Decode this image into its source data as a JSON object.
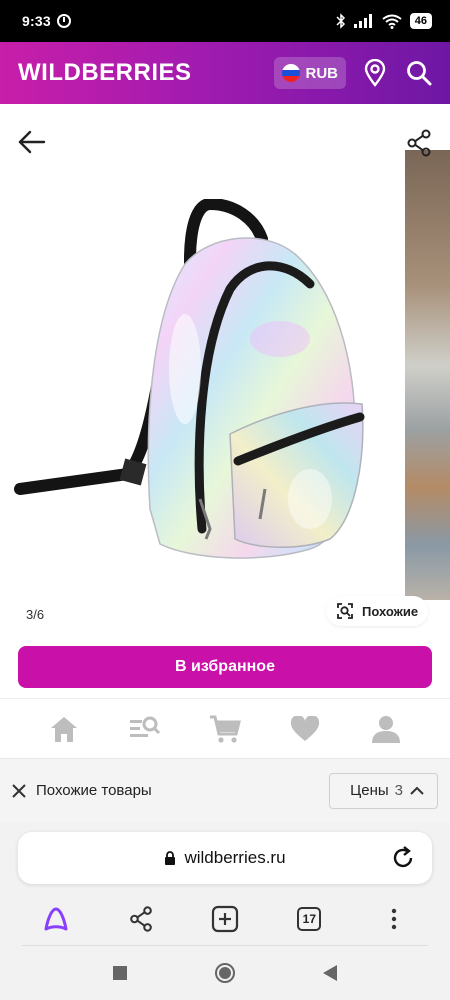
{
  "status_bar": {
    "time": "9:33",
    "battery": "46"
  },
  "header": {
    "logo": "WILDBERRIES",
    "currency": "RUB"
  },
  "gallery": {
    "counter": "3/6",
    "similar_label": "Похожие"
  },
  "favorite_button": {
    "label": "В избранное"
  },
  "similar_bar": {
    "label": "Похожие товары",
    "prices_label": "Цены",
    "prices_count": "3"
  },
  "browser": {
    "url": "wildberries.ru",
    "tabs_count": "17"
  },
  "colors": {
    "brand": "#c911a9",
    "header_gradient_start": "#c81ea9",
    "header_gradient_end": "#6e17a5",
    "assistant_accent": "#8a3ffc"
  },
  "icons": [
    "alarm-icon",
    "bluetooth-icon",
    "signal-icon",
    "wifi-icon",
    "location-pin-icon",
    "search-icon",
    "back-arrow-icon",
    "share-icon",
    "search-image-icon",
    "home-icon",
    "catalog-search-icon",
    "cart-icon",
    "heart-icon",
    "profile-icon",
    "close-icon",
    "chevron-up-icon",
    "lock-icon",
    "reload-icon",
    "alice-icon",
    "plus-icon",
    "more-icon",
    "nav-square-icon",
    "nav-circle-icon",
    "nav-back-icon"
  ]
}
